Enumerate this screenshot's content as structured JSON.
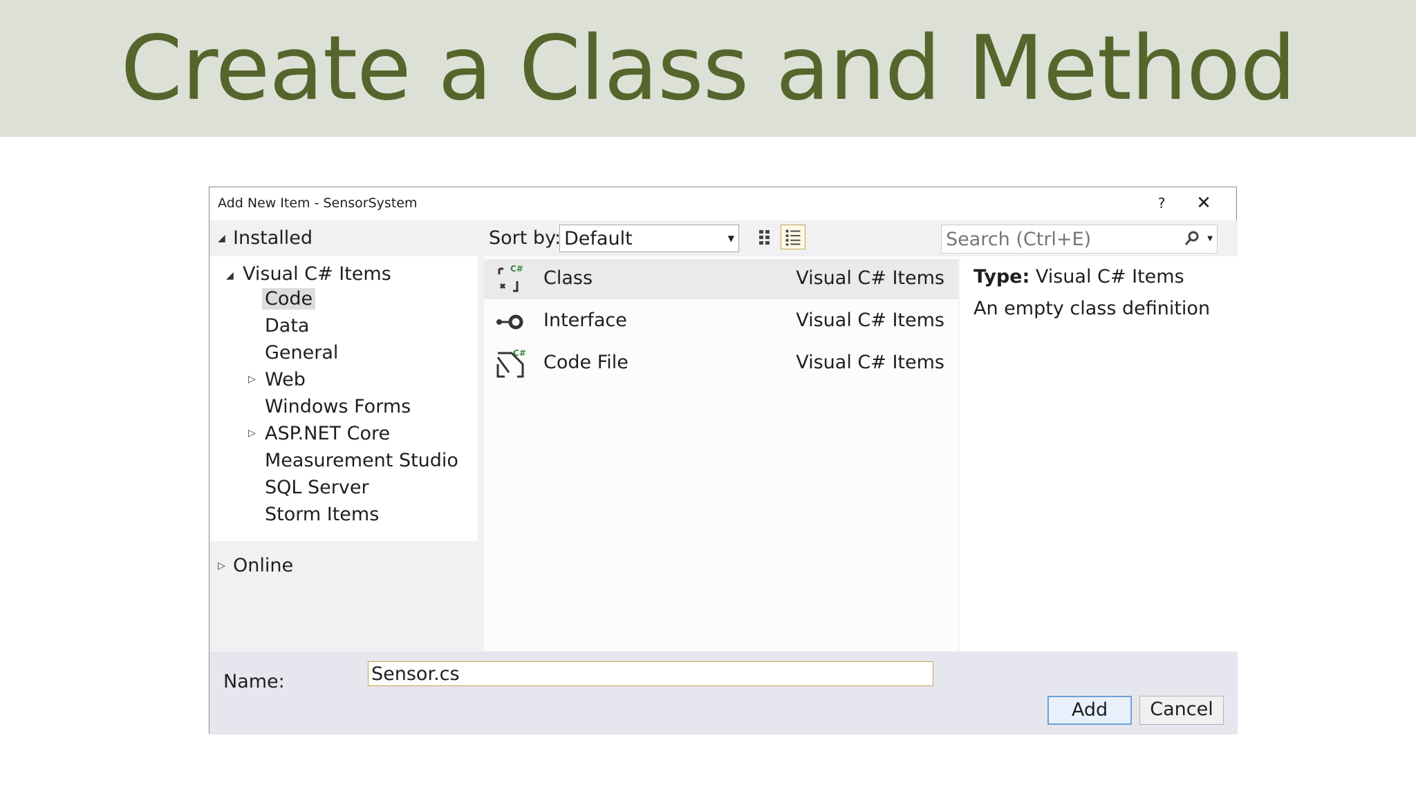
{
  "slide": {
    "title": "Create a Class and Method"
  },
  "dialog": {
    "title": "Add New Item - SensorSystem",
    "help_label": "?",
    "close_label": "✕",
    "left": {
      "installed_label": "Installed",
      "tree_root": "Visual C# Items",
      "tree_items": [
        "Code",
        "Data",
        "General",
        "Web",
        "Windows Forms",
        "ASP.NET Core",
        "Measurement Studio",
        "SQL Server",
        "Storm Items"
      ],
      "online_label": "Online"
    },
    "toolbar": {
      "sort_label": "Sort by:",
      "sort_value": "Default",
      "search_placeholder": "Search (Ctrl+E)"
    },
    "items": [
      {
        "name": "Class",
        "category": "Visual C# Items",
        "icon": "class-icon"
      },
      {
        "name": "Interface",
        "category": "Visual C# Items",
        "icon": "interface-icon"
      },
      {
        "name": "Code File",
        "category": "Visual C# Items",
        "icon": "code-file-icon"
      }
    ],
    "detail": {
      "type_label": "Type:",
      "type_value": "Visual C# Items",
      "description": "An empty class definition"
    },
    "bottom": {
      "name_label": "Name:",
      "name_value": "Sensor.cs",
      "add_label": "Add",
      "cancel_label": "Cancel"
    }
  }
}
